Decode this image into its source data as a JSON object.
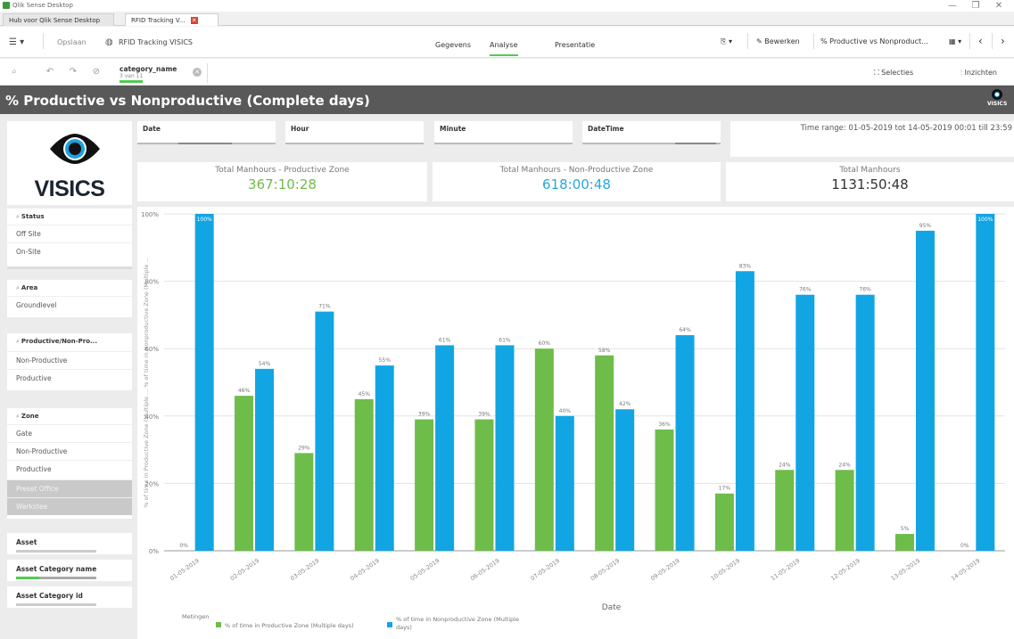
{
  "window": {
    "title": "Qlik Sense Desktop",
    "controls": {
      "minimize": "—",
      "restore": "❐",
      "close": "✕"
    }
  },
  "tabs": [
    {
      "label": "Hub voor Qlik Sense Desktop"
    },
    {
      "label": "RFID Tracking V...",
      "close": "✕"
    }
  ],
  "toolbar": {
    "menu": "☰ ▾",
    "save": "Opslaan",
    "app_icon": "globe-icon",
    "app_name": "RFID Tracking VISICS",
    "nav_tabs": [
      "Gegevens",
      "Analyse",
      "Presentatie"
    ],
    "active_nav": "Analyse",
    "bookmark": "⎘ ▾",
    "edit_label": "Bewerken",
    "sheet_selector": "% Productive vs Nonproduct...",
    "sheet_selector_icon": "▦ ▾",
    "prev": "‹",
    "next": "›"
  },
  "selections": {
    "chip_field": "category_name",
    "chip_count": "3 van 11",
    "clear": "✕",
    "selecties_label": "Selecties",
    "inzichten_label": "Inzichten"
  },
  "sheet": {
    "title": "% Productive vs Nonproductive (Complete days)",
    "mini_logo": "VISICS"
  },
  "logo": {
    "text": "VISICS"
  },
  "filters": [
    {
      "label": "Date"
    },
    {
      "label": "Hour"
    },
    {
      "label": "Minute"
    },
    {
      "label": "DateTime"
    }
  ],
  "time_range": "Time range: 01-05-2019 tot 14-05-2019 00:01 till 23:59",
  "kpis": [
    {
      "label": "Total Manhours - Productive Zone",
      "value": "367:10:28",
      "color": "#6ebc4a"
    },
    {
      "label": "Total Manhours - Non-Productive Zone",
      "value": "618:00:48",
      "color": "#2aa6db"
    },
    {
      "label": "Total Manhours",
      "value": "1131:50:48",
      "color": "#333333"
    }
  ],
  "sidebar": {
    "status": {
      "title": "Status",
      "items": [
        "Off Site",
        "On-Site"
      ]
    },
    "area": {
      "title": "Area",
      "items": [
        "Groundlevel"
      ]
    },
    "productive": {
      "title": "Productive/Non-Pro...",
      "items": [
        "Non-Productive",
        "Productive"
      ]
    },
    "zone": {
      "title": "Zone",
      "items": [
        "Gate",
        "Non-Productive",
        "Productive"
      ],
      "excluded": [
        "Preset Office",
        "Werkstee"
      ]
    },
    "asset": "Asset",
    "asset_category_name": "Asset Category name",
    "asset_category_id": "Asset Category id"
  },
  "chart_data": {
    "type": "bar",
    "categories": [
      "01-05-2019",
      "02-05-2019",
      "03-05-2019",
      "04-05-2019",
      "05-05-2019",
      "06-05-2019",
      "07-05-2019",
      "08-05-2019",
      "09-05-2019",
      "10-05-2019",
      "11-05-2019",
      "12-05-2019",
      "13-05-2019",
      "14-05-2019"
    ],
    "series": [
      {
        "name": "% of time in Productive Zone (Multiple days)",
        "color": "#6ebc4a",
        "values": [
          0,
          46,
          29,
          45,
          39,
          39,
          60,
          58,
          36,
          17,
          24,
          24,
          5,
          0
        ],
        "labels": [
          "0%",
          "46%",
          "29%",
          "45%",
          "39%",
          "39%",
          "60%",
          "58%",
          "36%",
          "17%",
          "24%",
          "24%",
          "5%",
          "0%"
        ]
      },
      {
        "name": "% of time in Nonproductive Zone (Multiple days)",
        "color": "#12a5e4",
        "values": [
          100,
          54,
          71,
          55,
          61,
          61,
          40,
          42,
          64,
          83,
          76,
          76,
          95,
          100
        ],
        "labels": [
          "100%",
          "54%",
          "71%",
          "55%",
          "61%",
          "61%",
          "40%",
          "42%",
          "64%",
          "83%",
          "76%",
          "76%",
          "95%",
          "100%"
        ]
      }
    ],
    "y_ticks": [
      "0%",
      "20%",
      "40%",
      "60%",
      "80%",
      "100%"
    ],
    "ylim": [
      0,
      100
    ],
    "xlabel": "Date",
    "ylabel": "% of time in Productive Zone (Multiple ... % of time in Nonproductive Zone (Multiple ...",
    "legend_title": "Metingen",
    "legend_position": "bottom-left",
    "grid": true
  }
}
